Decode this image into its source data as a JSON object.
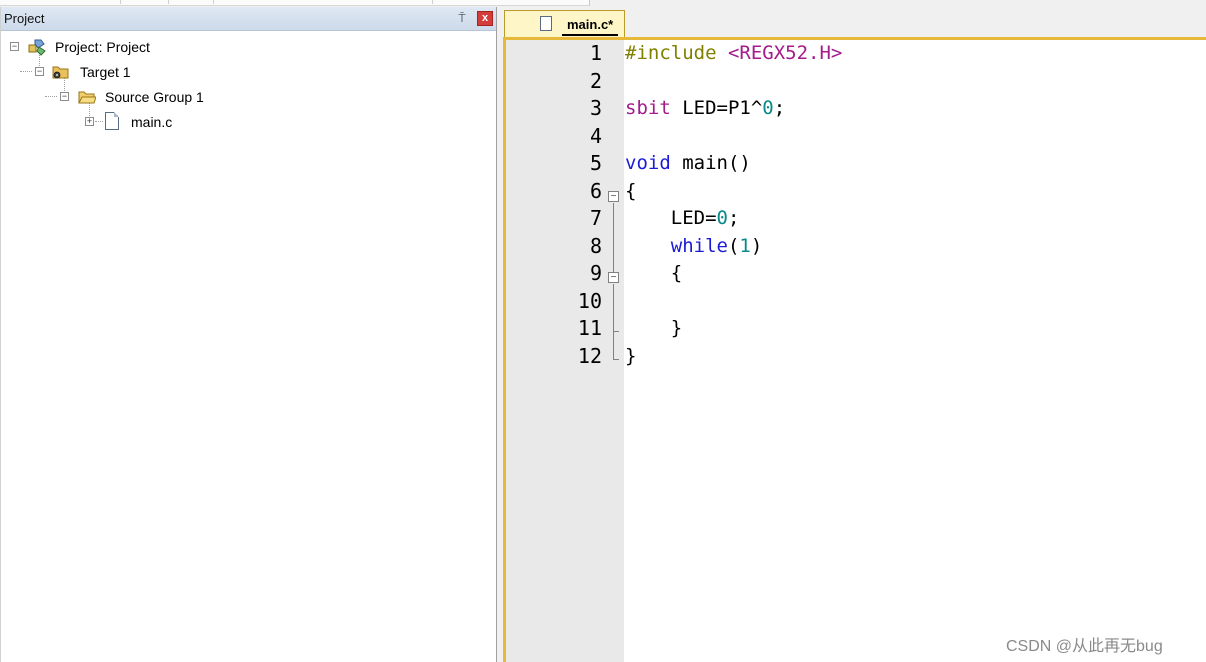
{
  "project_panel": {
    "title": "Project",
    "pin_glyph": "⍑",
    "close_glyph": "x",
    "tree": [
      {
        "label": "Project: Project",
        "icon": "project-icon",
        "expander": "−"
      },
      {
        "label": "Target 1",
        "icon": "target-folder-icon",
        "expander": "−"
      },
      {
        "label": "Source Group 1",
        "icon": "folder-icon",
        "expander": "−"
      },
      {
        "label": "main.c",
        "icon": "file-icon",
        "expander": "+"
      }
    ]
  },
  "editor": {
    "tab_label": "main.c*",
    "line_numbers": [
      "1",
      "2",
      "3",
      "4",
      "5",
      "6",
      "7",
      "8",
      "9",
      "10",
      "11",
      "12"
    ],
    "fold_glyph": "−",
    "code_lines": [
      [
        {
          "t": "#include ",
          "c": "pre"
        },
        {
          "t": "<REGX52.H>",
          "c": "inc"
        }
      ],
      [],
      [
        {
          "t": "sbit",
          "c": "type"
        },
        {
          "t": " LED=P1^",
          "c": ""
        },
        {
          "t": "0",
          "c": "num"
        },
        {
          "t": ";",
          "c": ""
        }
      ],
      [],
      [
        {
          "t": "void",
          "c": "kw"
        },
        {
          "t": " main()",
          "c": ""
        }
      ],
      [
        {
          "t": "{",
          "c": ""
        }
      ],
      [
        {
          "t": "    LED=",
          "c": ""
        },
        {
          "t": "0",
          "c": "num"
        },
        {
          "t": ";",
          "c": ""
        }
      ],
      [
        {
          "t": "    ",
          "c": ""
        },
        {
          "t": "while",
          "c": "kw"
        },
        {
          "t": "(",
          "c": ""
        },
        {
          "t": "1",
          "c": "num"
        },
        {
          "t": ")",
          "c": ""
        }
      ],
      [
        {
          "t": "    {",
          "c": ""
        }
      ],
      [],
      [
        {
          "t": "    }",
          "c": ""
        }
      ],
      [
        {
          "t": "}",
          "c": ""
        }
      ]
    ]
  },
  "watermark": "CSDN @从此再无bug",
  "colors": {
    "accent": "#e6b93a",
    "keyword": "#1c1cd6",
    "preprocessor": "#808000",
    "type": "#a31b8c",
    "number": "#0a8a8a"
  }
}
